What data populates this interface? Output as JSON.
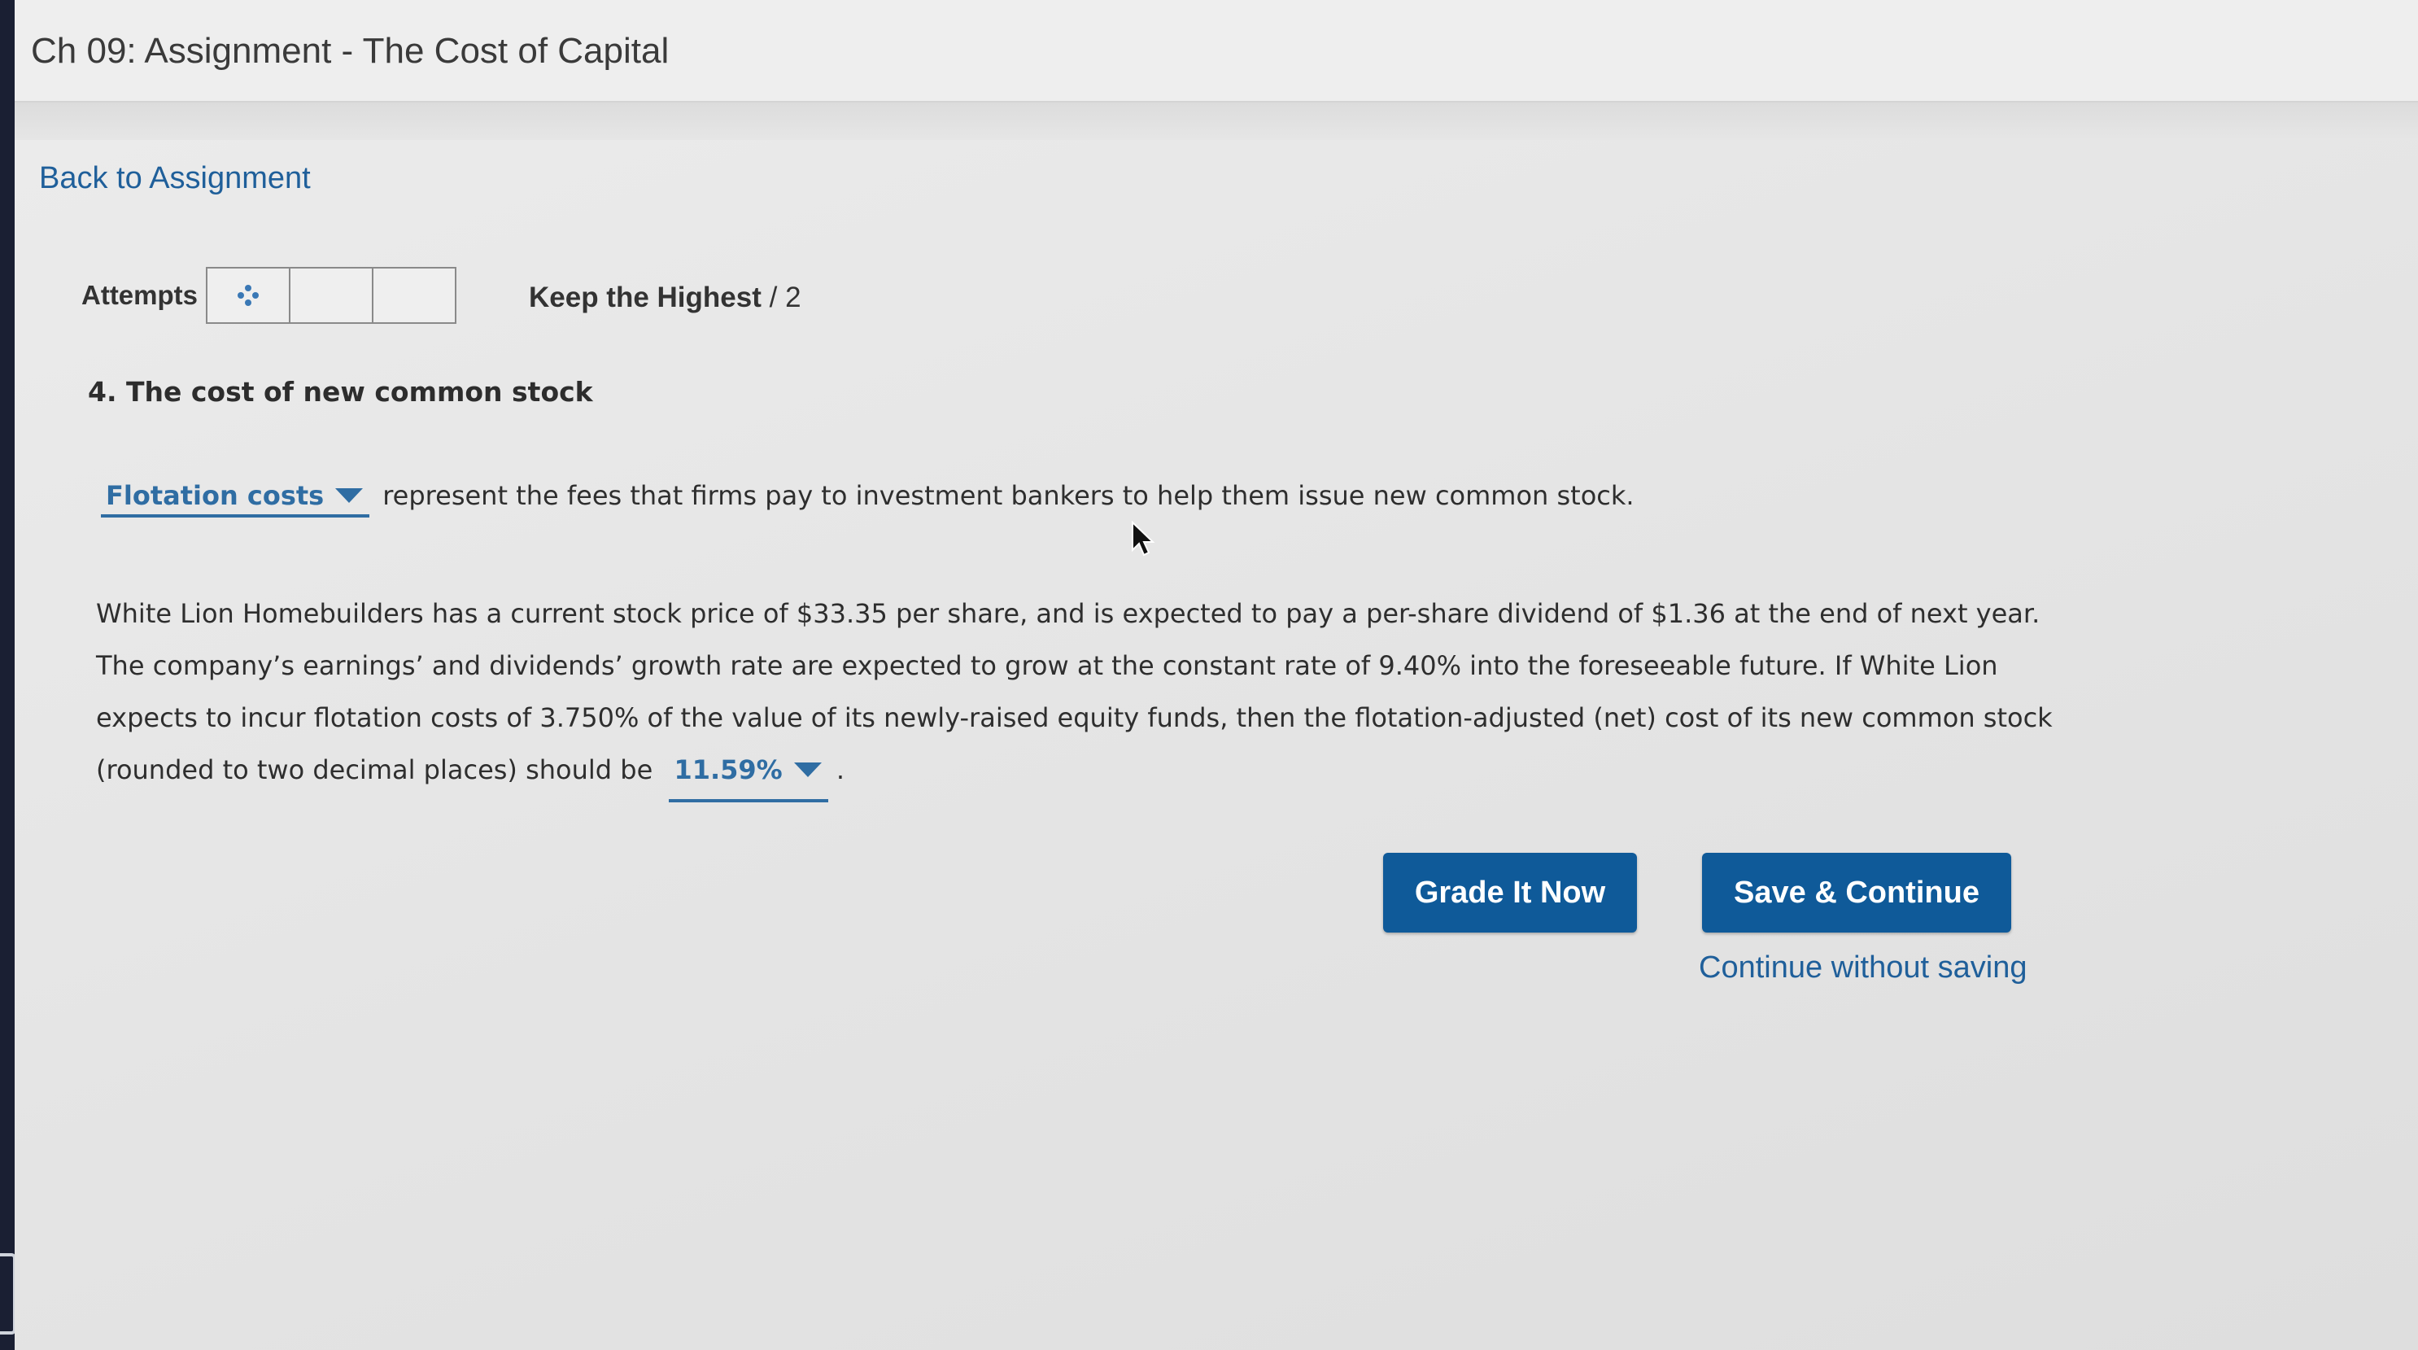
{
  "header": {
    "title": "Ch 09: Assignment - The Cost of Capital"
  },
  "nav": {
    "back_link": "Back to Assignment"
  },
  "attempts": {
    "label": "Attempts",
    "keep_highest": "Keep the Highest",
    "max": "/ 2"
  },
  "question": {
    "title": "4. The cost of new common stock",
    "dropdown1_value": "Flotation costs",
    "sentence1_rest": "represent the fees that firms pay to investment bankers to help them issue new common stock.",
    "paragraph_line1": "White Lion Homebuilders has a current stock price of $33.35 per share, and is expected to pay a per-share dividend of $1.36 at the end of next year.",
    "paragraph_line2": "The company’s earnings’ and dividends’ growth rate are expected to grow at the constant rate of 9.40% into the foreseeable future. If White Lion",
    "paragraph_line3": "expects to incur flotation costs of 3.750% of the value of its newly-raised equity funds, then the flotation-adjusted (net) cost of its new common stock",
    "paragraph_line4_pre": "(rounded to two decimal places) should be",
    "dropdown2_value": "11.59%",
    "paragraph_line4_post": "."
  },
  "actions": {
    "grade_label": "Grade It Now",
    "save_label": "Save & Continue",
    "continue_label": "Continue without saving"
  },
  "colors": {
    "accent": "#0f5a99",
    "link": "#1f5f9a",
    "dropdown": "#2f6da3"
  }
}
